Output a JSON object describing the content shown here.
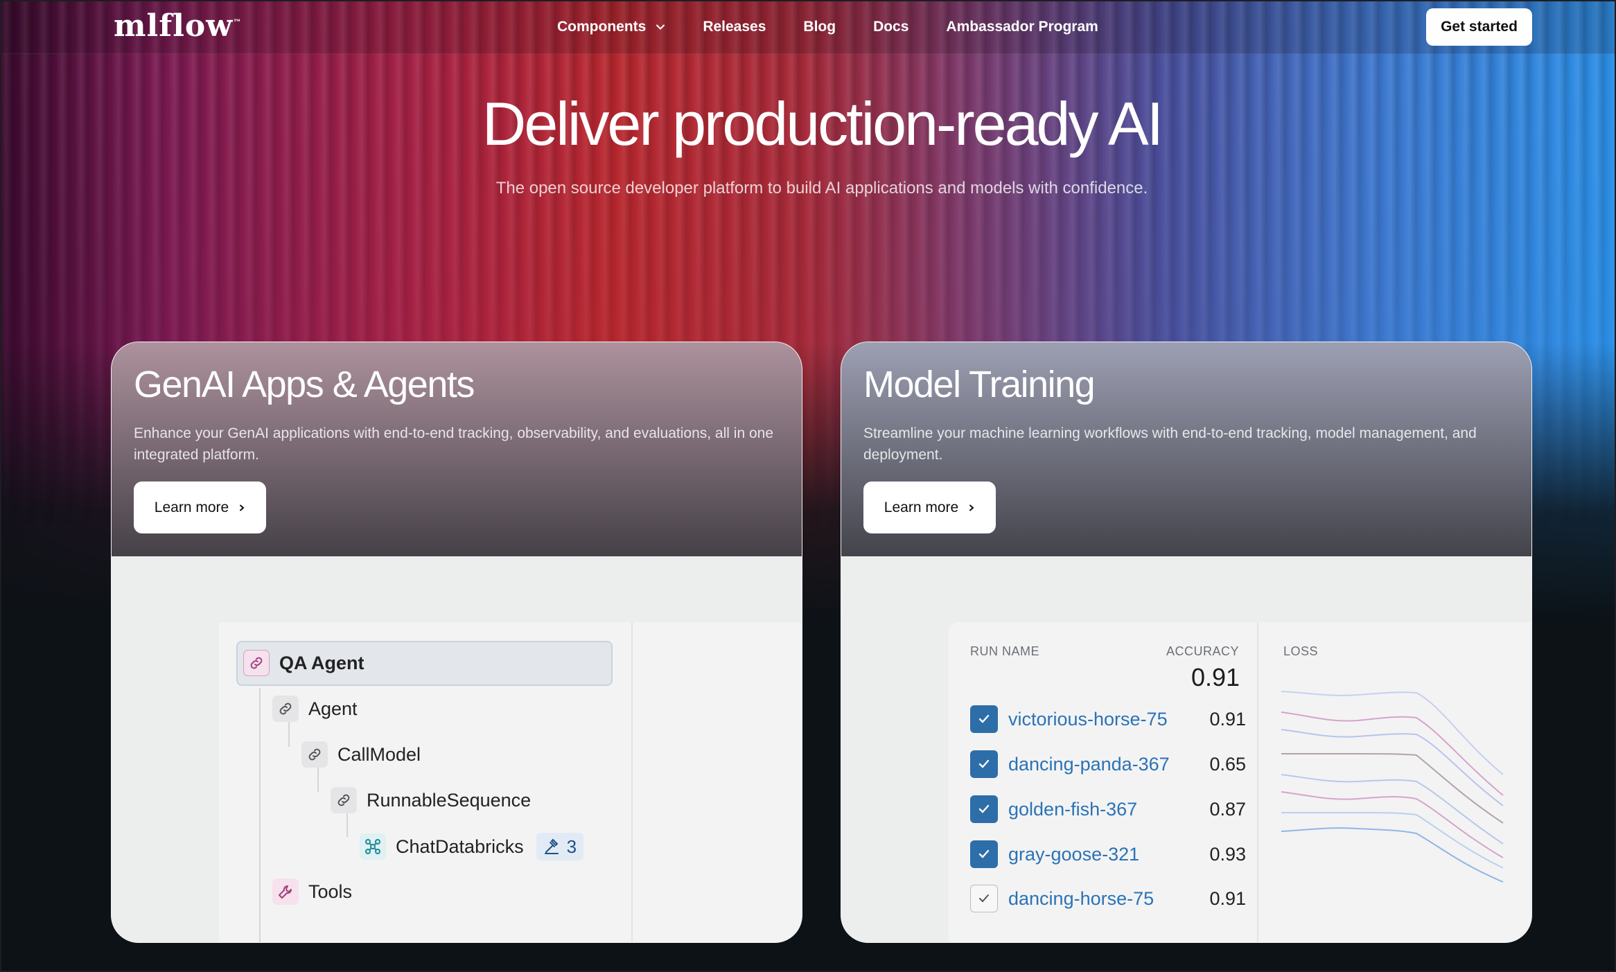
{
  "nav": {
    "logo": "mlflow",
    "logo_tm": "™",
    "links": [
      "Components",
      "Releases",
      "Blog",
      "Docs",
      "Ambassador Program"
    ],
    "cta": "Get started"
  },
  "hero": {
    "title": "Deliver production-ready AI",
    "subtitle": "The open source developer platform to build AI applications and models with confidence."
  },
  "cards": [
    {
      "title": "GenAI Apps & Agents",
      "description": "Enhance your GenAI applications with end-to-end tracking, observability, and evaluations, all in one integrated platform.",
      "button": "Learn more"
    },
    {
      "title": "Model Training",
      "description": "Streamline your machine learning workflows with end-to-end tracking, model management, and deployment.",
      "button": "Learn more"
    }
  ],
  "trace": {
    "nodes": [
      {
        "label": "QA Agent",
        "icon": "link-icon"
      },
      {
        "label": "Agent",
        "icon": "link-icon"
      },
      {
        "label": "CallModel",
        "icon": "link-icon"
      },
      {
        "label": "RunnableSequence",
        "icon": "link-icon"
      },
      {
        "label": "ChatDatabricks",
        "icon": "model-icon",
        "badge": "3"
      },
      {
        "label": "Tools",
        "icon": "wrench-icon"
      }
    ]
  },
  "runs": {
    "headers": {
      "name": "RUN NAME",
      "accuracy": "ACCURACY",
      "loss": "LOSS"
    },
    "summary_accuracy": "0.91",
    "rows": [
      {
        "name": "victorious-horse-75",
        "accuracy": "0.91",
        "checked": true
      },
      {
        "name": "dancing-panda-367",
        "accuracy": "0.65",
        "checked": true
      },
      {
        "name": "golden-fish-367",
        "accuracy": "0.87",
        "checked": true
      },
      {
        "name": "gray-goose-321",
        "accuracy": "0.93",
        "checked": true
      },
      {
        "name": "dancing-horse-75",
        "accuracy": "0.91",
        "checked": false
      }
    ]
  },
  "colors": {
    "brand_link": "#2a73b5",
    "checkbox": "#2e6ea8",
    "background": "#0c1216"
  }
}
